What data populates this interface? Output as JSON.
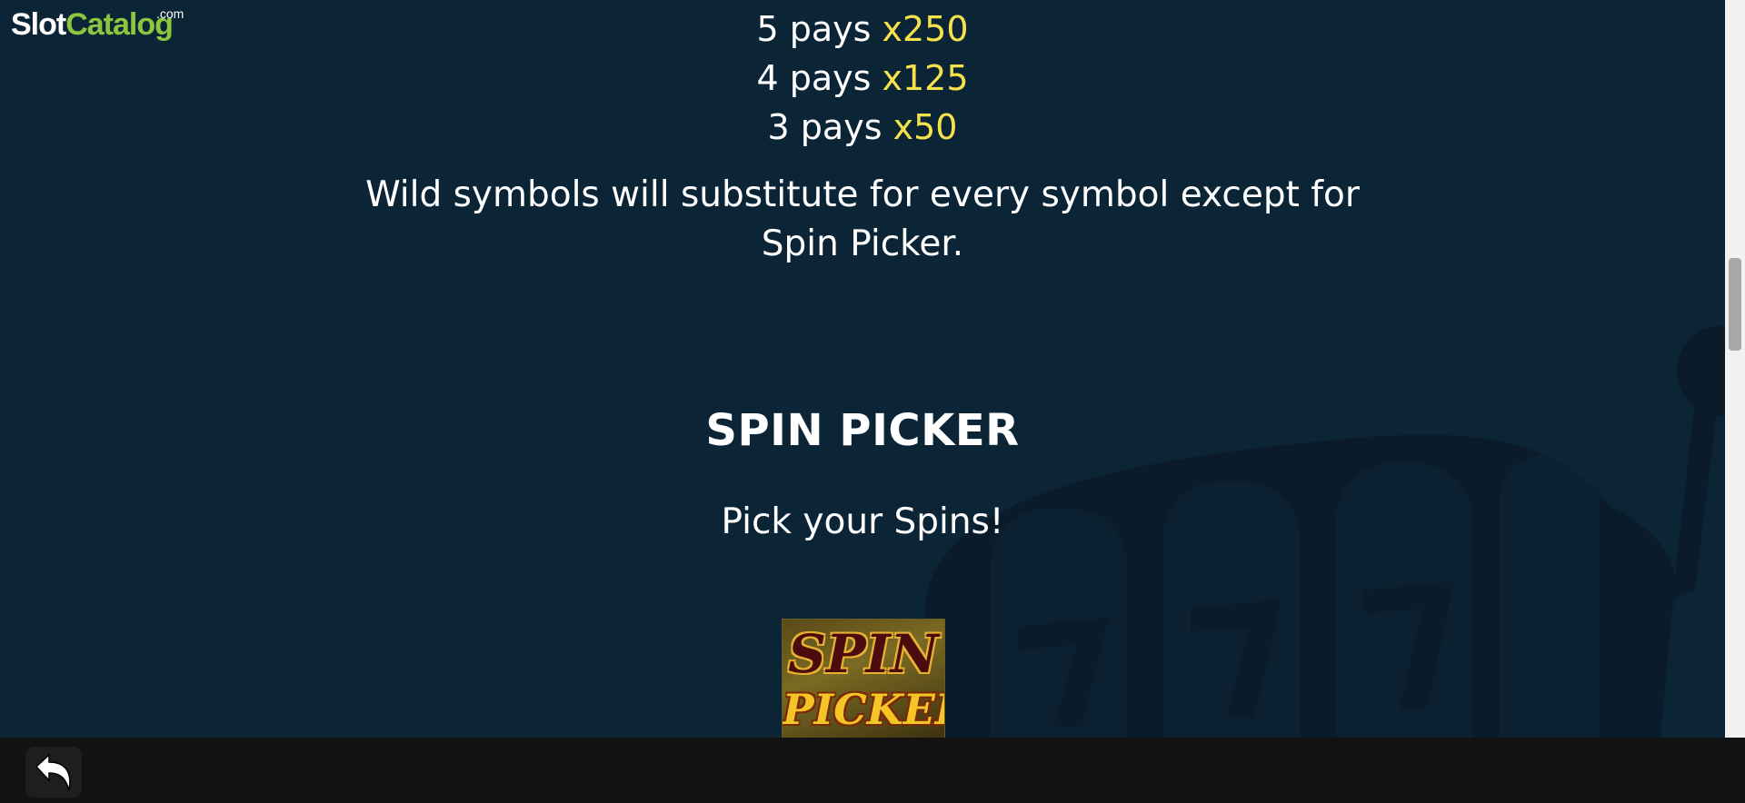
{
  "logo": {
    "slot": "Slot",
    "catalog": "Catalog",
    "com": ".com"
  },
  "paytable": [
    {
      "count": "5 pays",
      "multiplier": "x250"
    },
    {
      "count": "4 pays",
      "multiplier": "x125"
    },
    {
      "count": "3 pays",
      "multiplier": "x50"
    }
  ],
  "wild": {
    "description": "Wild symbols will substitute for every symbol except for Spin Picker."
  },
  "spin_picker": {
    "title": "SPIN PICKER",
    "subtitle": "Pick your Spins!",
    "symbol_line1": "SPIN",
    "symbol_line2": "PICKER"
  },
  "bottom_bar": {
    "back_icon": "undo-arrow-icon"
  },
  "colors": {
    "background": "#0c2536",
    "multiplier": "#f5e24a",
    "logo_accent": "#8cc63f",
    "bottom_bar": "#121212"
  },
  "scrollbar": {
    "position_fraction": 0.4
  }
}
